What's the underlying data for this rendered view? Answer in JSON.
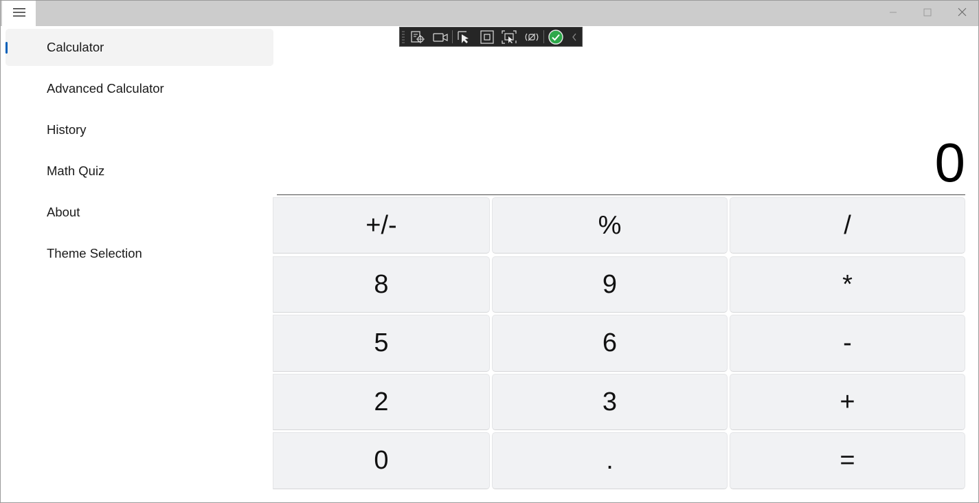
{
  "window": {
    "caption_buttons": [
      "minimize-icon",
      "maximize-icon",
      "close-icon"
    ],
    "colors": {
      "titlebar": "#cccccc",
      "accent": "#005fb8",
      "key_bg": "#f1f2f4",
      "nav_selected_bg": "#f3f3f3"
    }
  },
  "nav": {
    "menu_icon": "hamburger-icon",
    "items": [
      {
        "label": "Calculator",
        "selected": true
      },
      {
        "label": "Advanced Calculator",
        "selected": false
      },
      {
        "label": "History",
        "selected": false
      },
      {
        "label": "Math Quiz",
        "selected": false
      },
      {
        "label": "About",
        "selected": false
      },
      {
        "label": "Theme Selection",
        "selected": false
      }
    ]
  },
  "debug_toolbar": {
    "icons": [
      "select-element-icon",
      "record-icon",
      "pointer-select-icon",
      "layout-bounds-icon",
      "track-focus-icon",
      "binding-failures-icon",
      "checkmark-icon",
      "collapse-chevron-icon"
    ]
  },
  "calculator": {
    "display": "0",
    "keys": [
      [
        "+/-",
        "%",
        "/"
      ],
      [
        "8",
        "9",
        "*"
      ],
      [
        "5",
        "6",
        "-"
      ],
      [
        "2",
        "3",
        "+"
      ],
      [
        "0",
        ".",
        "="
      ]
    ]
  }
}
